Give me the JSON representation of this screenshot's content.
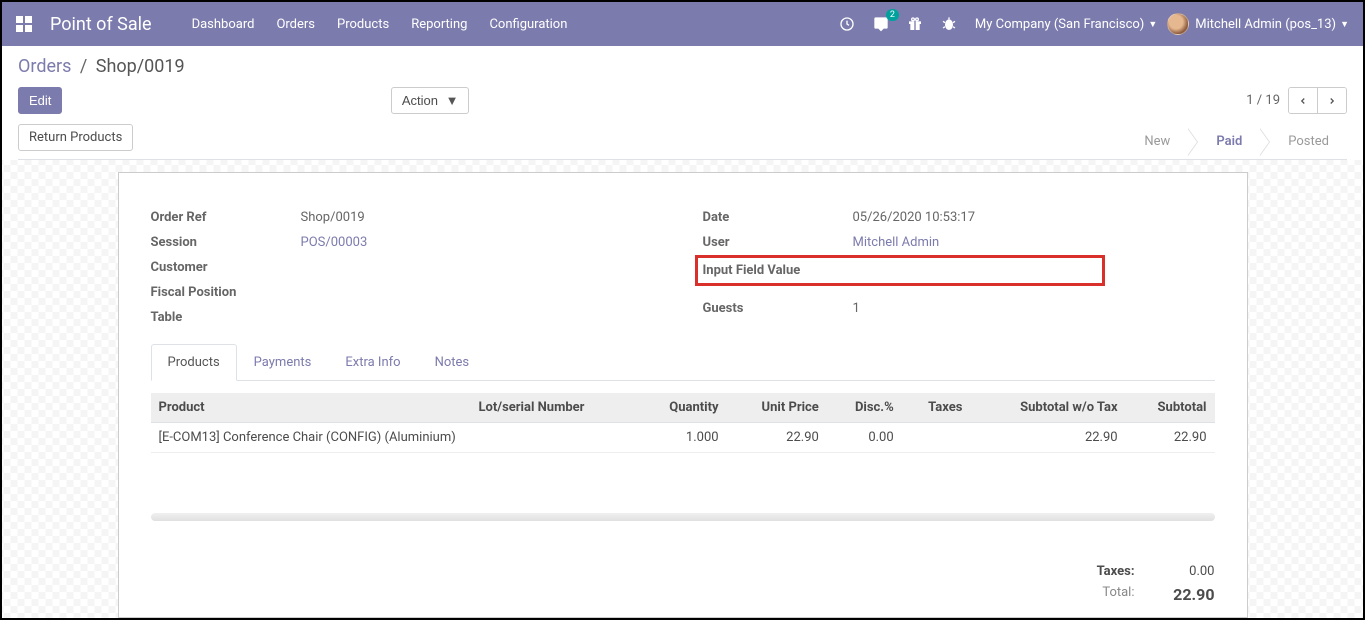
{
  "navbar": {
    "brand": "Point of Sale",
    "links": [
      "Dashboard",
      "Orders",
      "Products",
      "Reporting",
      "Configuration"
    ],
    "messages_badge": "2",
    "company": "My Company (San Francisco)",
    "user": "Mitchell Admin (pos_13)"
  },
  "breadcrumb": {
    "parent": "Orders",
    "current": "Shop/0019"
  },
  "buttons": {
    "edit": "Edit",
    "action": "Action",
    "return_products": "Return Products"
  },
  "pager": {
    "text": "1 / 19"
  },
  "status": {
    "new": "New",
    "paid": "Paid",
    "posted": "Posted"
  },
  "form": {
    "left": {
      "order_ref_label": "Order Ref",
      "order_ref_value": "Shop/0019",
      "session_label": "Session",
      "session_value": "POS/00003",
      "customer_label": "Customer",
      "customer_value": "",
      "fiscal_label": "Fiscal Position",
      "fiscal_value": "",
      "table_label": "Table",
      "table_value": ""
    },
    "right": {
      "date_label": "Date",
      "date_value": "05/26/2020 10:53:17",
      "user_label": "User",
      "user_value": "Mitchell Admin",
      "input_label": "Input Field Value",
      "input_value": "",
      "guests_label": "Guests",
      "guests_value": "1"
    }
  },
  "tabs": {
    "products": "Products",
    "payments": "Payments",
    "extra": "Extra Info",
    "notes": "Notes"
  },
  "table": {
    "headers": {
      "product": "Product",
      "lot": "Lot/serial Number",
      "qty": "Quantity",
      "price": "Unit Price",
      "disc": "Disc.%",
      "taxes": "Taxes",
      "sub_wo": "Subtotal w/o Tax",
      "sub": "Subtotal"
    },
    "rows": [
      {
        "product": "[E-COM13] Conference Chair (CONFIG) (Aluminium)",
        "lot": "",
        "qty": "1.000",
        "price": "22.90",
        "disc": "0.00",
        "taxes": "",
        "sub_wo": "22.90",
        "sub": "22.90"
      }
    ]
  },
  "totals": {
    "taxes_label": "Taxes:",
    "taxes_value": "0.00",
    "total_label": "Total:",
    "total_value": "22.90"
  }
}
